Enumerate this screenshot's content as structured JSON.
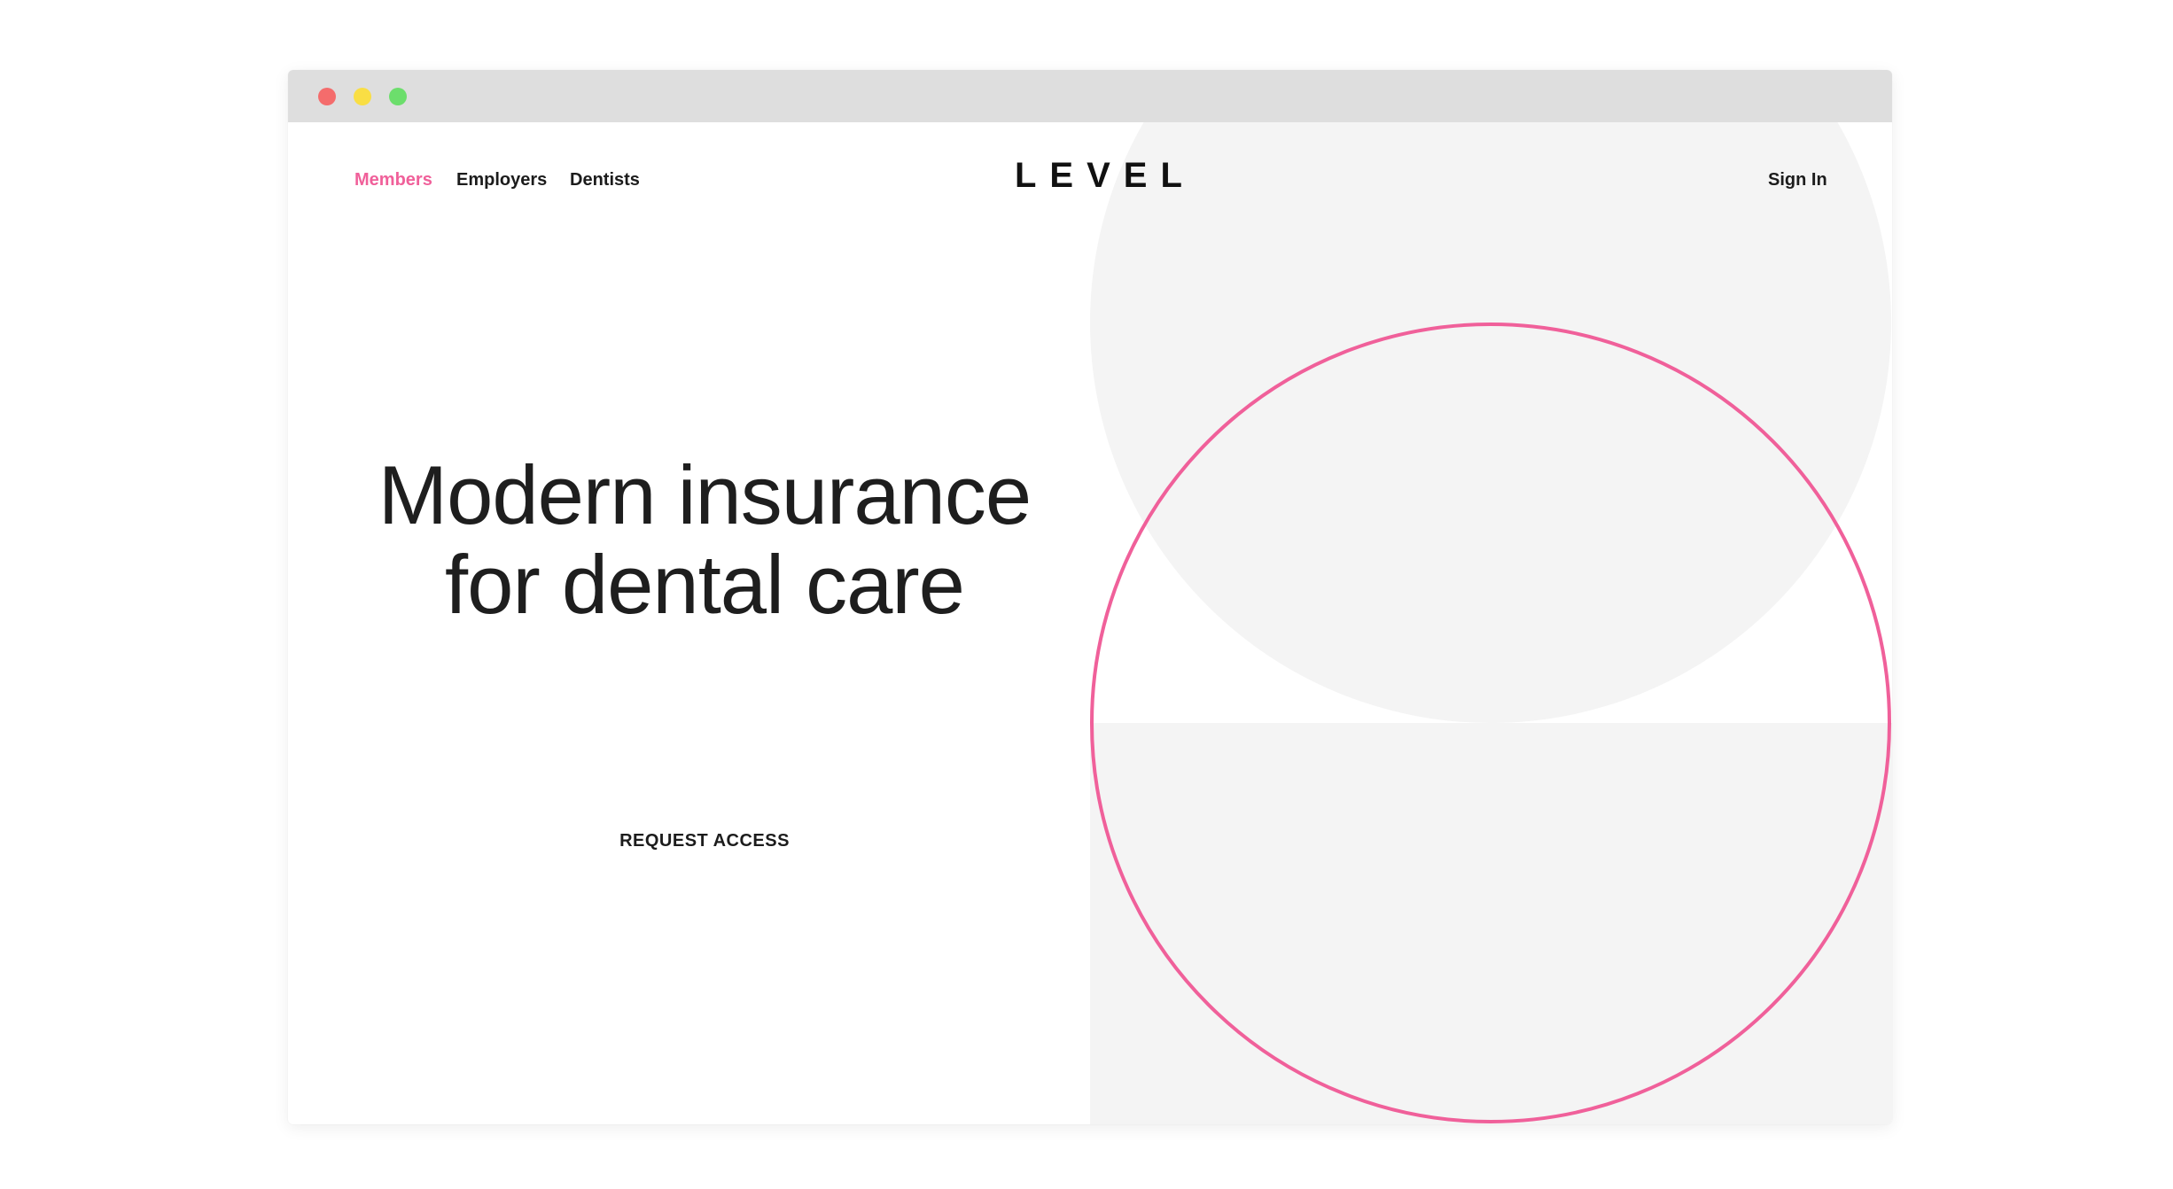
{
  "window": {
    "controls": [
      "close",
      "minimize",
      "zoom"
    ],
    "colors": {
      "close": "#f46c6c",
      "minimize": "#f9de44",
      "zoom": "#6cde6c",
      "titlebar": "#dedede"
    }
  },
  "nav": {
    "items": [
      {
        "label": "Members",
        "active": true
      },
      {
        "label": "Employers",
        "active": false
      },
      {
        "label": "Dentists",
        "active": false
      }
    ],
    "sign_in": "Sign In"
  },
  "brand": {
    "logo": "LEVEL"
  },
  "hero": {
    "headline_line1": "Modern insurance",
    "headline_line2": "for dental care",
    "cta_label": "REQUEST ACCESS"
  },
  "colors": {
    "accent": "#f0609a",
    "text": "#1c1c1c",
    "panel": "#f4f4f4"
  }
}
